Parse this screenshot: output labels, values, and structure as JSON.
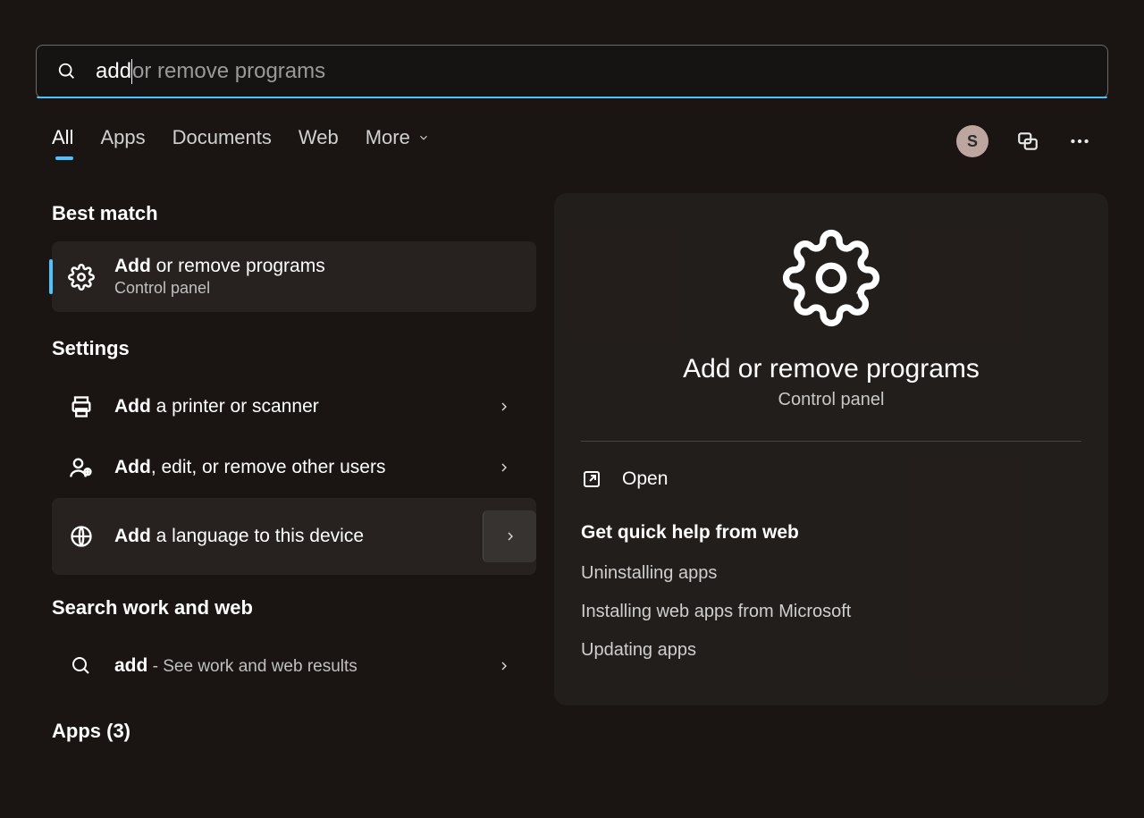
{
  "search": {
    "typed": "add",
    "ghost": " or remove programs"
  },
  "tabs": [
    "All",
    "Apps",
    "Documents",
    "Web",
    "More"
  ],
  "active_tab": 0,
  "profile_initial": "S",
  "left": {
    "best_match_header": "Best match",
    "best": {
      "title_bold": "Add",
      "title_rest": " or remove programs",
      "subtitle": "Control panel"
    },
    "settings_header": "Settings",
    "settings": [
      {
        "bold": "Add",
        "rest": " a printer or scanner"
      },
      {
        "bold": "Add",
        "rest": ", edit, or remove other users"
      },
      {
        "bold": "Add",
        "rest": " a language to this device"
      }
    ],
    "web_header": "Search work and web",
    "web": {
      "bold": "add",
      "dash_rest": " - See work and web results"
    },
    "apps_header": "Apps (3)"
  },
  "right": {
    "title": "Add or remove programs",
    "subtitle": "Control panel",
    "open_label": "Open",
    "help_header": "Get quick help from web",
    "help_links": [
      "Uninstalling apps",
      "Installing web apps from Microsoft",
      "Updating apps"
    ]
  }
}
